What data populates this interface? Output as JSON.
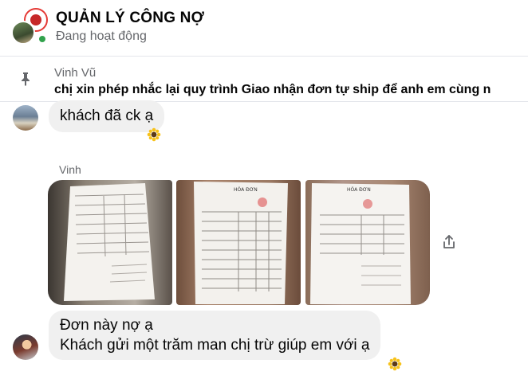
{
  "header": {
    "title": "QUẢN LÝ CÔNG NỢ",
    "status": "Đang hoạt động"
  },
  "pinned": {
    "sender": "Vinh Vũ",
    "text": "chị xin phép nhắc lại quy trình Giao nhận đơn tự ship để anh em cùng n",
    "icon": "pin-icon"
  },
  "messages": [
    {
      "text": "khách đã ck ạ",
      "reaction": "sunflower"
    },
    {
      "sender": "Vinh",
      "photos": [
        "invoice-photo-1",
        "invoice-photo-2",
        "invoice-photo-3"
      ]
    },
    {
      "lines": [
        "Đơn này nợ ạ",
        "Khách gửi một trăm man chị trừ giúp em với ạ"
      ],
      "reaction": "sunflower"
    }
  ],
  "colors": {
    "bubble": "#f0f0f0",
    "online": "#31a24c",
    "secondary_text": "#65676b"
  }
}
